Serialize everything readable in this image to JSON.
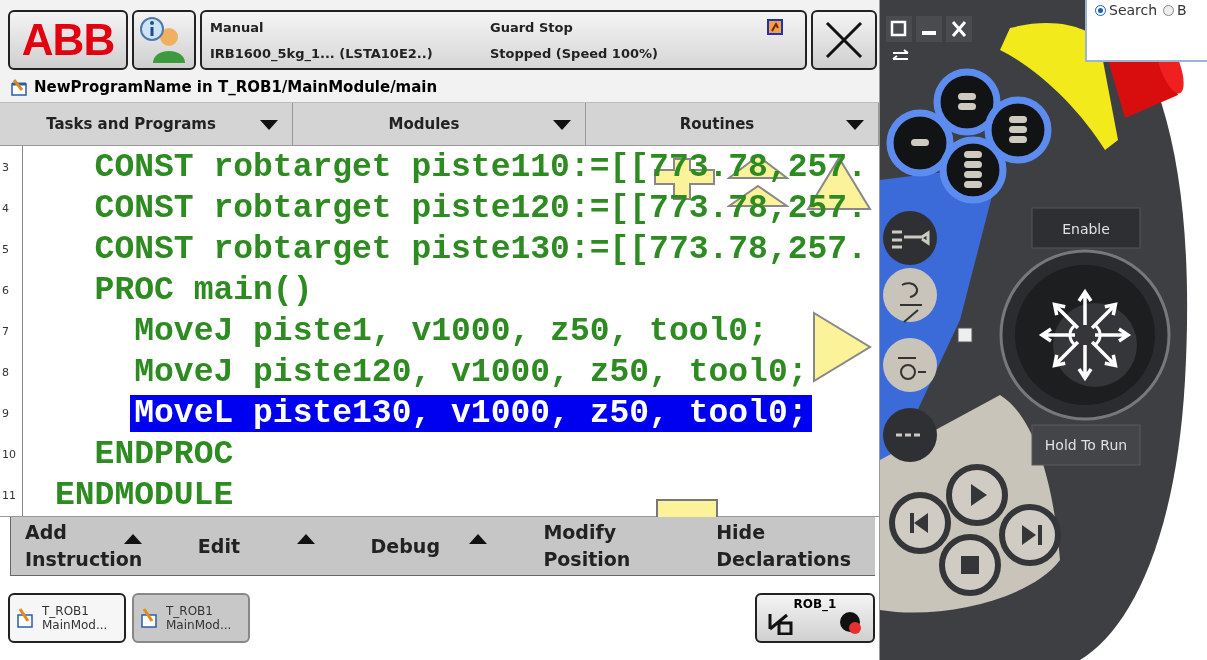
{
  "header": {
    "logo": "ABB",
    "status": {
      "mode": "Manual",
      "robot": "IRB1600_5kg_1... (LSTA10E2..)",
      "state": "Guard Stop",
      "speed": "Stopped (Speed 100%)"
    }
  },
  "path": "NewProgramName in T_ROB1/MainModule/main",
  "dropdowns": [
    "Tasks and Programs",
    "Modules",
    "Routines"
  ],
  "code_lines": [
    {
      "number": "3",
      "text": "  CONST robtarget piste110:=[[773.78,257.",
      "selected": false
    },
    {
      "number": "4",
      "text": "  CONST robtarget piste120:=[[773.78,257.",
      "selected": false
    },
    {
      "number": "5",
      "text": "  CONST robtarget piste130:=[[773.78,257.",
      "selected": false
    },
    {
      "number": "6",
      "text": "  PROC main()",
      "selected": false
    },
    {
      "number": "7",
      "text": "    MoveJ piste1, v1000, z50, tool0;",
      "selected": false
    },
    {
      "number": "8",
      "text": "    MoveJ piste120, v1000, z50, tool0;",
      "selected": false
    },
    {
      "number": "9",
      "text": "    MoveL piste130, v1000, z50, tool0;",
      "selected": true
    },
    {
      "number": "10",
      "text": "  ENDPROC",
      "selected": false
    },
    {
      "number": "11",
      "text": "ENDMODULE",
      "selected": false
    }
  ],
  "menu": [
    {
      "lines": [
        "Add",
        "Instruction"
      ],
      "submenu": true
    },
    {
      "lines": [
        "Edit"
      ],
      "submenu": true
    },
    {
      "lines": [
        "Debug"
      ],
      "submenu": true
    },
    {
      "lines": [
        "Modify",
        "Position"
      ],
      "submenu": false
    },
    {
      "lines": [
        "Hide",
        "Declarations"
      ],
      "submenu": false
    }
  ],
  "taskbar": {
    "tasks": [
      {
        "task": "T_ROB1",
        "module": "MainMod...",
        "selected": true
      },
      {
        "task": "T_ROB1",
        "module": "MainMod...",
        "selected": false
      }
    ],
    "robot": "ROB_1"
  },
  "pendant": {
    "enable": "Enable",
    "hold_to_run": "Hold To Run"
  },
  "background_window": {
    "radios": [
      {
        "label": "Search",
        "selected": true
      },
      {
        "label": "B",
        "selected": false
      }
    ]
  }
}
